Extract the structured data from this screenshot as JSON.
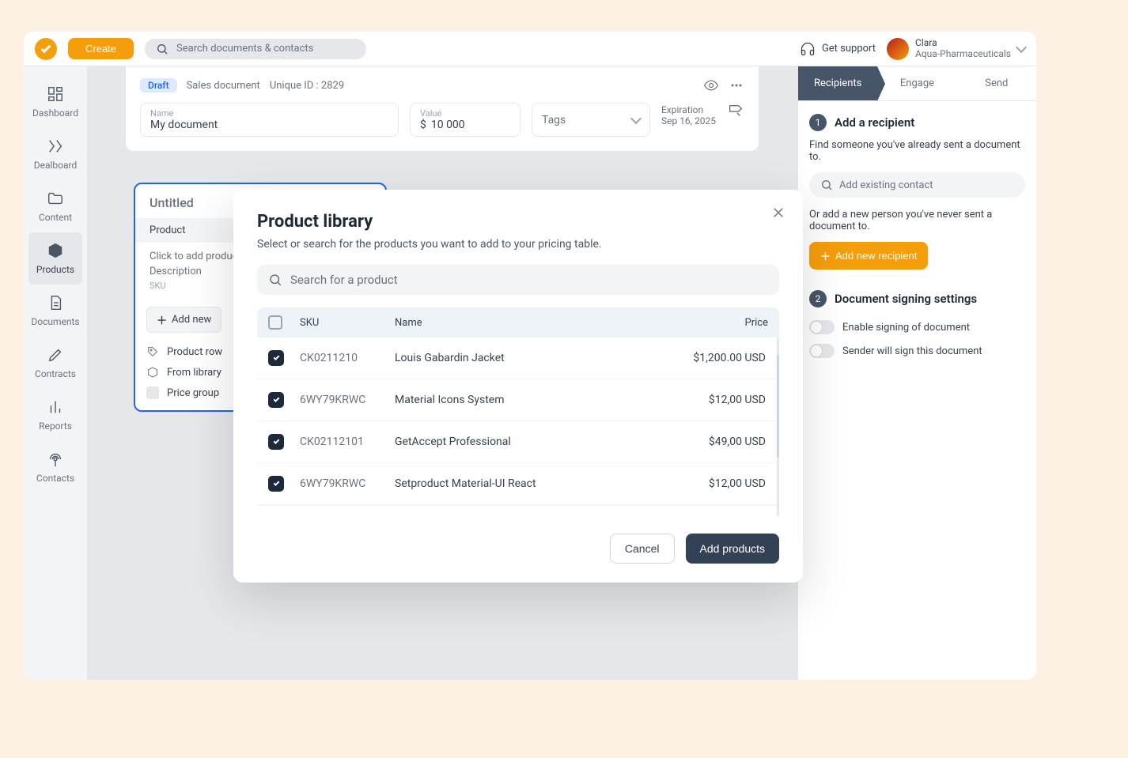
{
  "topbar": {
    "create": "Create",
    "search_placeholder": "Search documents & contacts",
    "support": "Get support",
    "user_name": "Clara",
    "user_company": "Aqua-Pharmaceuticals"
  },
  "sidebar": {
    "items": [
      {
        "label": "Dashboard"
      },
      {
        "label": "Dealboard"
      },
      {
        "label": "Content"
      },
      {
        "label": "Products"
      },
      {
        "label": "Documents"
      },
      {
        "label": "Contracts"
      },
      {
        "label": "Reports"
      },
      {
        "label": "Contacts"
      }
    ]
  },
  "doc": {
    "badge": "Draft",
    "type": "Sales document",
    "unique_id": "Unique ID : 2829",
    "name_label": "Name",
    "name_value": "My document",
    "value_label": "Value",
    "value_currency": "$",
    "value_amount": "10 000",
    "tags_label": "Tags",
    "expir_label": "Expiration",
    "expir_value": "Sep 16, 2025"
  },
  "pricing": {
    "title": "Untitled",
    "col_product": "Product",
    "placeholder_line1": "Click to add product",
    "placeholder_line2": "Description",
    "placeholder_sku": "SKU",
    "add_new": "Add new",
    "opt_row": "Product row",
    "opt_library": "From library",
    "opt_group": "Price group"
  },
  "right": {
    "steps": [
      "Recipients",
      "Engage",
      "Send"
    ],
    "s1_num": "1",
    "s1_title": "Add a recipient",
    "s1_desc": "Find someone you've already sent a document to.",
    "s1_contact_placeholder": "Add existing contact",
    "s1_or": "Or add a new person you've never sent a document to.",
    "s1_button": "Add new recipient",
    "s2_num": "2",
    "s2_title": "Document signing settings",
    "s2_t1": "Enable signing of document",
    "s2_t2": "Sender will sign this document"
  },
  "modal": {
    "title": "Product library",
    "subtitle": "Select or search for the products you want to add to your pricing table.",
    "search_placeholder": "Search for a product",
    "col_sku": "SKU",
    "col_name": "Name",
    "col_price": "Price",
    "rows": [
      {
        "sku": "CK0211210",
        "name": "Louis Gabardin Jacket",
        "price": "$1,200.00 USD"
      },
      {
        "sku": "6WY79KRWC",
        "name": "Material Icons System",
        "price": "$12,00 USD"
      },
      {
        "sku": "CK02112101",
        "name": "GetAccept Professional",
        "price": "$49,00 USD"
      },
      {
        "sku": "6WY79KRWC",
        "name": "Setproduct Material-UI React",
        "price": "$12,00 USD"
      }
    ],
    "cancel": "Cancel",
    "add": "Add products"
  }
}
